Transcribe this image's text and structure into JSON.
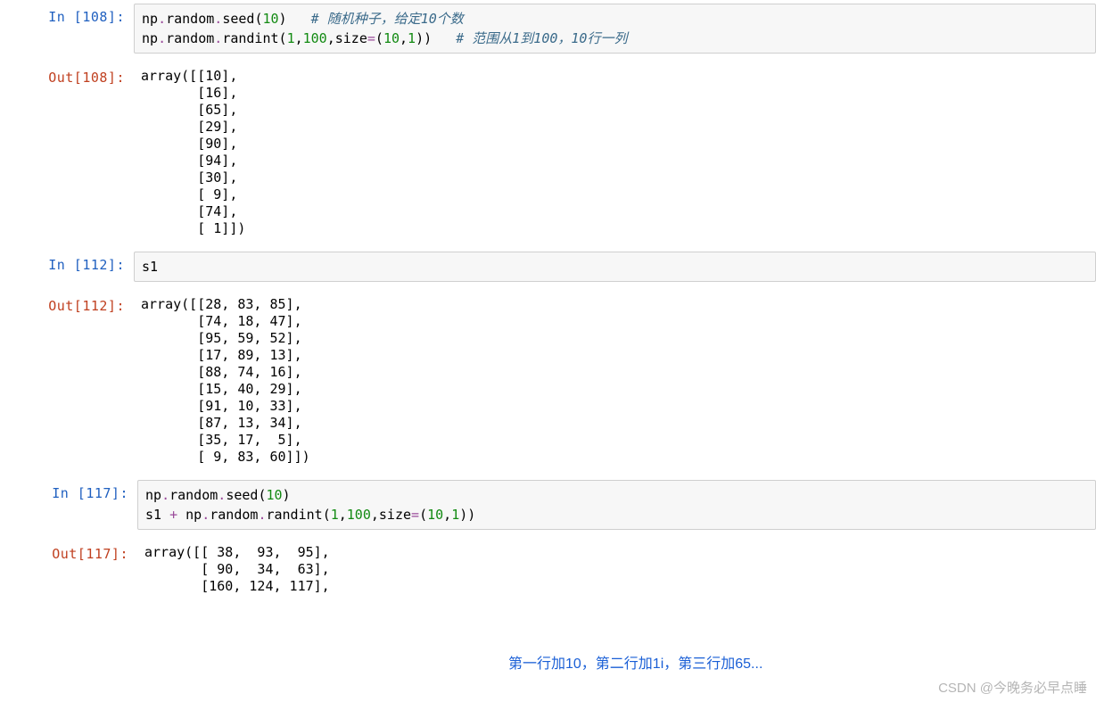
{
  "cells": {
    "c108": {
      "in_prompt": "In  [108]:",
      "out_prompt": "Out[108]:",
      "code": {
        "seg1": "np",
        "dot1": ".",
        "seg2": "random",
        "dot2": ".",
        "seg3": "seed",
        "p1": "(",
        "n1": "10",
        "p2": ")",
        "sp1": "   ",
        "cm1": "# 随机种子，给定10个数",
        "nl": "\n",
        "seg4": "np",
        "dot3": ".",
        "seg5": "random",
        "dot4": ".",
        "seg6": "randint",
        "p3": "(",
        "n2": "1",
        "c1": ",",
        "n3": "100",
        "c2": ",",
        "sp2": "size",
        "eq": "=",
        "p4": "(",
        "n4": "10",
        "c3": ",",
        "n5": "1",
        "p5": ")",
        "p6": ")",
        "sp3": "   ",
        "cm2": "# 范围从1到100，10行一列"
      },
      "output": "array([[10],\n       [16],\n       [65],\n       [29],\n       [90],\n       [94],\n       [30],\n       [ 9],\n       [74],\n       [ 1]])"
    },
    "c112": {
      "in_prompt": "In  [112]:",
      "out_prompt": "Out[112]:",
      "code": {
        "s1": "s1"
      },
      "output": "array([[28, 83, 85],\n       [74, 18, 47],\n       [95, 59, 52],\n       [17, 89, 13],\n       [88, 74, 16],\n       [15, 40, 29],\n       [91, 10, 33],\n       [87, 13, 34],\n       [35, 17,  5],\n       [ 9, 83, 60]])"
    },
    "c117": {
      "in_prompt": "In  [117]:",
      "out_prompt": "Out[117]:",
      "code": {
        "seg1": "np",
        "dot1": ".",
        "seg2": "random",
        "dot2": ".",
        "seg3": "seed",
        "p1": "(",
        "n1": "10",
        "p2": ")",
        "nl": "\n",
        "seg4": "s1 ",
        "op": "+",
        "sp": " ",
        "seg5": "np",
        "dot3": ".",
        "seg6": "random",
        "dot4": ".",
        "seg7": "randint",
        "p3": "(",
        "n2": "1",
        "c1": ",",
        "n3": "100",
        "c2": ",",
        "seg8": "size",
        "eq": "=",
        "p4": "(",
        "n4": "10",
        "c3": ",",
        "n5": "1",
        "p5": ")",
        "p6": ")"
      },
      "output": "array([[ 38,  93,  95],\n       [ 90,  34,  63],\n       [160, 124, 117],"
    }
  },
  "annotation": "第一行加10，第二行加1i，第三行加65...",
  "watermark": "CSDN @今晚务必早点睡"
}
